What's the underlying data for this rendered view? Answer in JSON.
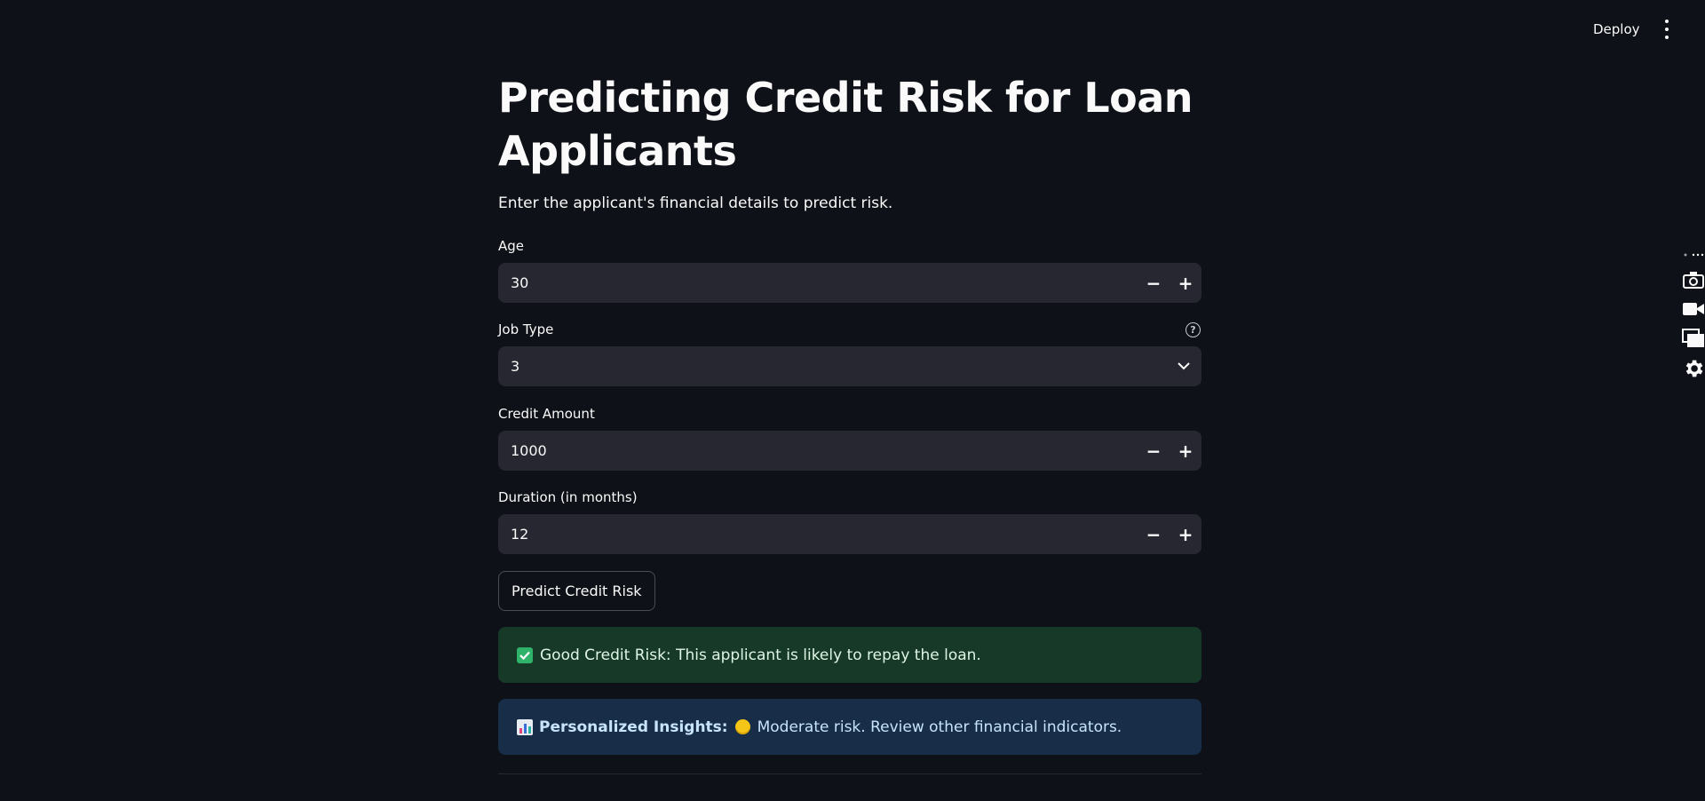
{
  "header": {
    "deploy_label": "Deploy"
  },
  "page": {
    "title": "Predicting Credit Risk for Loan Applicants",
    "subtitle": "Enter the applicant's financial details to predict risk."
  },
  "form": {
    "age": {
      "label": "Age",
      "value": "30"
    },
    "job_type": {
      "label": "Job Type",
      "value": "3",
      "help": "?"
    },
    "credit_amount": {
      "label": "Credit Amount",
      "value": "1000"
    },
    "duration": {
      "label": "Duration (in months)",
      "value": "12"
    },
    "minus": "−",
    "plus": "+"
  },
  "actions": {
    "predict_label": "Predict Credit Risk"
  },
  "results": {
    "success_text": "Good Credit Risk: This applicant is likely to repay the loan.",
    "insights_label": "Personalized Insights:",
    "insights_text": "Moderate risk. Review other financial indicators."
  },
  "colors": {
    "background": "#0e1117",
    "input_bg": "#262730",
    "success_bg": "#173928",
    "info_bg": "#172d48"
  }
}
